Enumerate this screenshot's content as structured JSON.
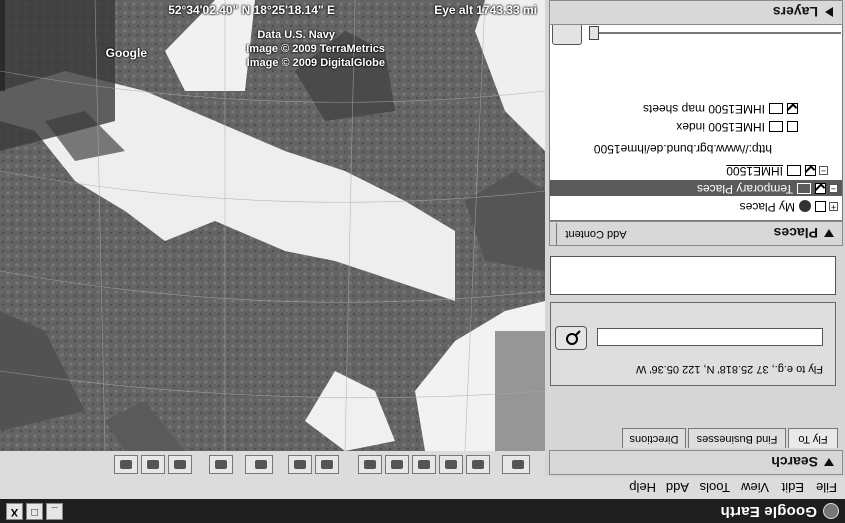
{
  "window": {
    "title": "Google Earth",
    "minimize": "_",
    "maximize": "□",
    "close": "X"
  },
  "menu": [
    "File",
    "Edit",
    "View",
    "Tools",
    "Add",
    "Help"
  ],
  "search": {
    "header": "Search",
    "tabs": [
      "Fly To",
      "Find Businesses",
      "Directions"
    ],
    "active_tab": "Fly To",
    "hint": "Fly to e.g., 37 25.818' N, 122 05.36' W",
    "input_value": "",
    "close_label": "x"
  },
  "places": {
    "header": "Places",
    "add_content": "Add Content",
    "items": [
      {
        "label": "My Places",
        "checked": false
      },
      {
        "label": "Temporary Places",
        "checked": true,
        "selected": true
      },
      {
        "label": "IHME1500",
        "checked": true
      },
      {
        "label": "http://www.bgr.bund.de/ihme1500"
      },
      {
        "label": "IHME1500 index",
        "checked": false
      },
      {
        "label": "IHME1500 map sheets",
        "checked": true
      }
    ]
  },
  "layers": {
    "header": "Layers"
  },
  "map": {
    "coords": "52°34'02.40\" N    18°25'18.14\" E",
    "eye_alt": "Eye alt  1743.33 mi",
    "credits": [
      "Data U.S. Navy",
      "Image © 2009 TerraMetrics",
      "Image © 2009 DigitalGlobe"
    ],
    "logo": "Google"
  },
  "colors": {
    "title_bar": "#1e1e1e",
    "panel": "#d6d6d6",
    "selection": "#5a5a5a"
  }
}
